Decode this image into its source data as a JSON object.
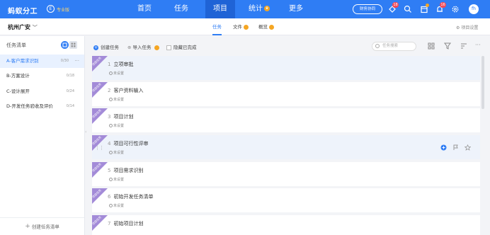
{
  "brand": {
    "name": "蚂蚁分工",
    "badge": "E",
    "edition": "专业版"
  },
  "nav": [
    {
      "label": "首页",
      "active": false
    },
    {
      "label": "任务",
      "active": false
    },
    {
      "label": "项目",
      "active": true
    },
    {
      "label": "统计",
      "active": false,
      "badge_icon": "crown-icon"
    },
    {
      "label": "更多",
      "active": false
    }
  ],
  "topbar": {
    "collab_label": "财务协同",
    "notif_badge_1": "18",
    "notif_badge_2": "16",
    "avatar_text": "fh"
  },
  "subbar": {
    "project": "杭州广安",
    "tabs": [
      {
        "label": "任务",
        "active": true
      },
      {
        "label": "文件",
        "active": false
      },
      {
        "label": "概览",
        "active": false
      }
    ],
    "settings_label": "项目设置"
  },
  "left": {
    "title": "任务清单",
    "items": [
      {
        "label": "A-客户需求识别",
        "count": "0/30",
        "active": true
      },
      {
        "label": "B-方案设计",
        "count": "0/18",
        "active": false
      },
      {
        "label": "C-设计展开",
        "count": "0/24",
        "active": false
      },
      {
        "label": "D-开发任务验收及评价",
        "count": "0/14",
        "active": false
      }
    ],
    "create_label": "创建任务清单"
  },
  "toolbar": {
    "create_task": "创建任务",
    "import_task": "导入任务",
    "hide_done": "隐藏已完成",
    "search_placeholder": "任务搜索"
  },
  "tasks": [
    {
      "num": "1",
      "title": "立项审批",
      "meta": "未设置",
      "ribbon": "项目任务",
      "highlight": true
    },
    {
      "num": "2",
      "title": "客户资料输入",
      "meta": "未设置",
      "ribbon": "项目任务",
      "highlight": false
    },
    {
      "num": "3",
      "title": "项目计划",
      "meta": "未设置",
      "ribbon": "项目任务",
      "highlight": false
    },
    {
      "num": "4",
      "title": "项目可行性评审",
      "meta": "未设置",
      "ribbon": "项目任务",
      "highlight": true
    },
    {
      "num": "5",
      "title": "项目需求识别",
      "meta": "未设置",
      "ribbon": "项目任务",
      "highlight": false
    },
    {
      "num": "6",
      "title": "初始开发任务清单",
      "meta": "未设置",
      "ribbon": "项目任务",
      "highlight": false
    },
    {
      "num": "7",
      "title": "初始项目计划",
      "meta": "",
      "ribbon": "项目任务",
      "highlight": false
    }
  ],
  "colors": {
    "primary": "#2f7df4",
    "ribbon": "#a38bd8",
    "badge": "#f24957",
    "crown": "#f5a623"
  }
}
